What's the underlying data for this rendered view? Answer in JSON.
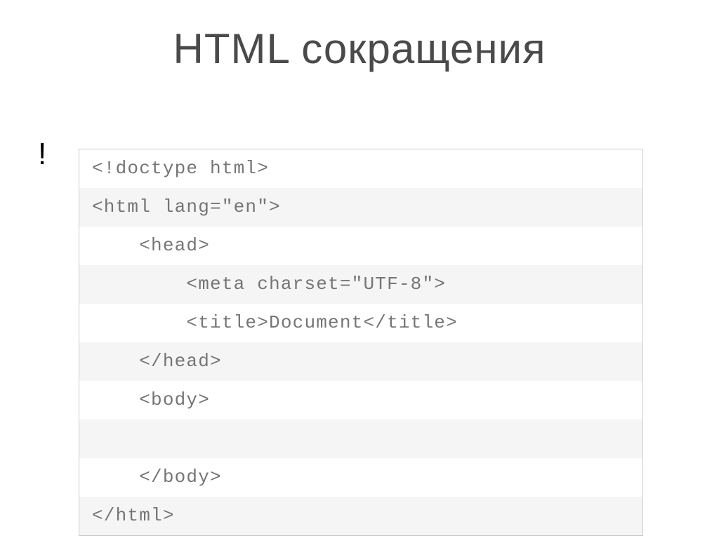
{
  "title": "HTML сокращения",
  "shortcut_trigger": "!",
  "code": {
    "lines": [
      "<!doctype html>",
      "<html lang=\"en\">",
      "    <head>",
      "        <meta charset=\"UTF-8\">",
      "        <title>Document</title>",
      "    </head>",
      "    <body>",
      "",
      "    </body>",
      "</html>"
    ]
  }
}
